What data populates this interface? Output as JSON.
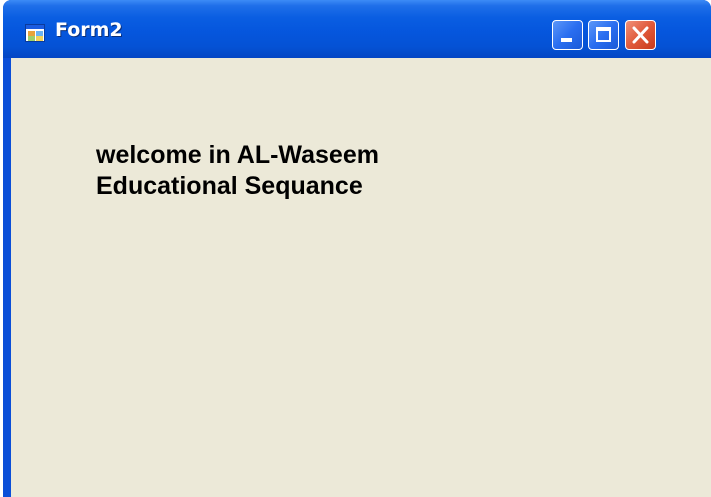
{
  "window": {
    "title": "Form2",
    "app_icon": "form-icon",
    "controls": {
      "minimize_icon": "minimize-icon",
      "maximize_icon": "maximize-icon",
      "close_icon": "close-icon"
    }
  },
  "content": {
    "welcome_line_1": "welcome in AL-Waseem",
    "welcome_line_2": "Educational Sequance"
  },
  "colors": {
    "title_bar": "#0556dd",
    "client_background": "#ece9d8",
    "close_button": "#e05a3b"
  }
}
